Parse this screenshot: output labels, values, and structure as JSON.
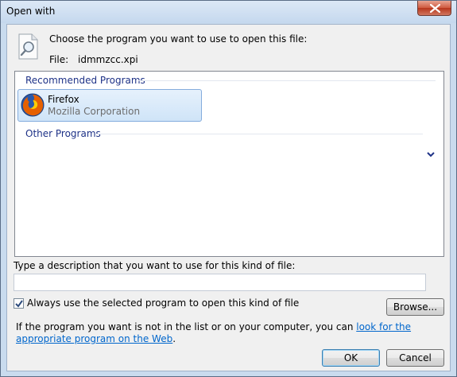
{
  "window": {
    "title": "Open with",
    "close_icon": "close-icon"
  },
  "header": {
    "prompt": "Choose the program you want to use to open this file:",
    "file_label": "File:",
    "file_name": "idmmzcc.xpi"
  },
  "program_list": {
    "recommended_header": "Recommended Programs",
    "other_header": "Other Programs",
    "programs": [
      {
        "name": "Firefox",
        "publisher": "Mozilla Corporation",
        "icon": "firefox-icon"
      }
    ]
  },
  "description": {
    "label": "Type a description that you want to use for this kind of file:",
    "value": ""
  },
  "always_use": {
    "label": "Always use the selected program to open this kind of file",
    "checked": true
  },
  "buttons": {
    "browse": "Browse...",
    "ok": "OK",
    "cancel": "Cancel"
  },
  "info": {
    "text": "If the program you want is not in the list or on your computer, you can ",
    "link_text": "look for the appropriate program on the Web",
    "end": "."
  },
  "colors": {
    "group_header": "#1e3287",
    "link": "#0066cc",
    "selected_tile": "#cfe4f8"
  }
}
